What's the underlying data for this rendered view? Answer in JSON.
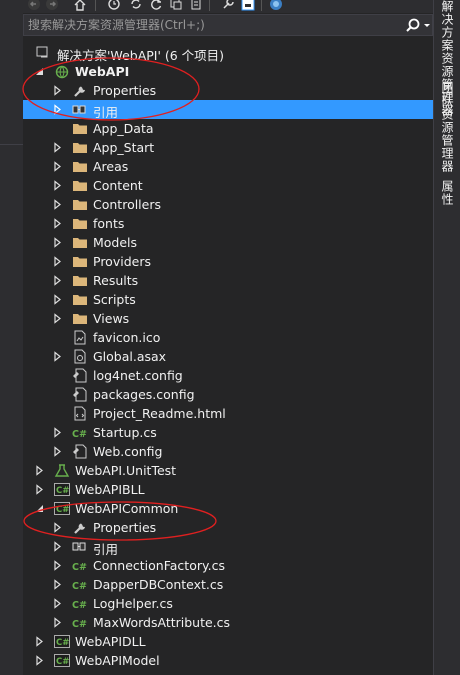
{
  "search": {
    "placeholder": "搜索解决方案资源管理器(Ctrl+;)"
  },
  "solution": {
    "label": "解决方案'WebAPI' (6 个项目)"
  },
  "tree": [
    {
      "label": "WebAPI",
      "icon": "web-project-icon",
      "bold": true
    },
    {
      "label": "Properties",
      "icon": "wrench-icon"
    },
    {
      "label": "引用",
      "icon": "references-icon",
      "selected": true
    },
    {
      "label": "App_Data",
      "icon": "folder-icon"
    },
    {
      "label": "App_Start",
      "icon": "folder-icon"
    },
    {
      "label": "Areas",
      "icon": "folder-icon"
    },
    {
      "label": "Content",
      "icon": "folder-icon"
    },
    {
      "label": "Controllers",
      "icon": "folder-icon"
    },
    {
      "label": "fonts",
      "icon": "folder-icon"
    },
    {
      "label": "Models",
      "icon": "folder-icon"
    },
    {
      "label": "Providers",
      "icon": "folder-icon"
    },
    {
      "label": "Results",
      "icon": "folder-icon"
    },
    {
      "label": "Scripts",
      "icon": "folder-icon"
    },
    {
      "label": "Views",
      "icon": "folder-icon"
    },
    {
      "label": "favicon.ico",
      "icon": "image-file-icon"
    },
    {
      "label": "Global.asax",
      "icon": "asax-file-icon"
    },
    {
      "label": "log4net.config",
      "icon": "config-file-icon"
    },
    {
      "label": "packages.config",
      "icon": "config-file-icon"
    },
    {
      "label": "Project_Readme.html",
      "icon": "html-file-icon"
    },
    {
      "label": "Startup.cs",
      "icon": "csharp-file-icon"
    },
    {
      "label": "Web.config",
      "icon": "config-file-icon"
    },
    {
      "label": "WebAPI.UnitTest",
      "icon": "test-project-icon"
    },
    {
      "label": "WebAPIBLL",
      "icon": "csharp-project-icon"
    },
    {
      "label": "WebAPICommon",
      "icon": "csharp-project-icon"
    },
    {
      "label": "Properties",
      "icon": "wrench-icon"
    },
    {
      "label": "引用",
      "icon": "references-icon"
    },
    {
      "label": "ConnectionFactory.cs",
      "icon": "csharp-file-icon"
    },
    {
      "label": "DapperDBContext.cs",
      "icon": "csharp-file-icon"
    },
    {
      "label": "LogHelper.cs",
      "icon": "csharp-file-icon"
    },
    {
      "label": "MaxWordsAttribute.cs",
      "icon": "csharp-file-icon"
    },
    {
      "label": "WebAPIDLL",
      "icon": "csharp-project-icon"
    },
    {
      "label": "WebAPIModel",
      "icon": "csharp-project-icon"
    }
  ],
  "right_rail": {
    "tab1": "解决方案资源管理器",
    "tab2": "团队资源管理器",
    "tab3": "属性"
  },
  "colors": {
    "selection": "#3399ff",
    "annotation": "#e02020",
    "folder": "#dcb67a",
    "csharp": "#68b04d"
  }
}
